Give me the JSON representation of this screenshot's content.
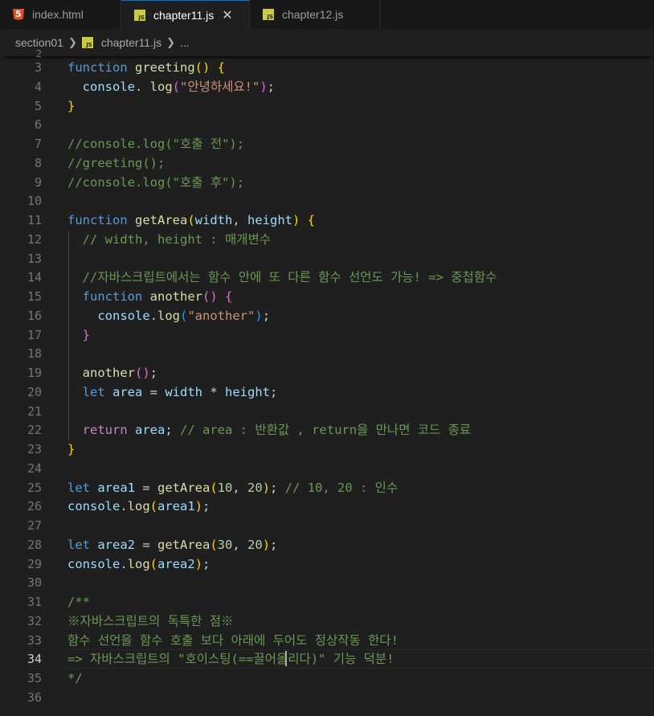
{
  "tabs": [
    {
      "label": "index.html",
      "icon": "html5-icon",
      "active": false
    },
    {
      "label": "chapter11.js",
      "icon": "js-icon",
      "active": true
    },
    {
      "label": "chapter12.js",
      "icon": "js-icon",
      "active": false
    }
  ],
  "breadcrumb": {
    "folder": "section01",
    "file": "chapter11.js",
    "more": "..."
  },
  "editor": {
    "first_line": 3,
    "current_line": 34,
    "gutter_top": "2",
    "lines": [
      [
        [
          "kw",
          "function "
        ],
        [
          "fn",
          "greeting"
        ],
        [
          "b1",
          "() {"
        ]
      ],
      [
        [
          "",
          "  "
        ],
        [
          "v",
          "console"
        ],
        [
          "",
          ". "
        ],
        [
          "fn",
          "log"
        ],
        [
          "b2",
          "("
        ],
        [
          "str",
          "\"안녕하세요!\""
        ],
        [
          "b2",
          ")"
        ],
        [
          "",
          ";"
        ]
      ],
      [
        [
          "b1",
          "}"
        ]
      ],
      [],
      [
        [
          "cm",
          "//console.log(\"호출 전\");"
        ]
      ],
      [
        [
          "cm",
          "//greeting();"
        ]
      ],
      [
        [
          "cm",
          "//console.log(\"호출 후\");"
        ]
      ],
      [],
      [
        [
          "kw",
          "function "
        ],
        [
          "fn",
          "getArea"
        ],
        [
          "b1",
          "("
        ],
        [
          "v",
          "width"
        ],
        [
          "",
          ", "
        ],
        [
          "v",
          "height"
        ],
        [
          "b1",
          ")"
        ],
        [
          "",
          " "
        ],
        [
          "b1",
          "{"
        ]
      ],
      [
        [
          "",
          "  "
        ],
        [
          "cm",
          "// width, height : 매개변수"
        ]
      ],
      [],
      [
        [
          "",
          "  "
        ],
        [
          "cm",
          "//자바스크립트에서는 함수 안에 또 다른 함수 선언도 가능! => 중첩함수"
        ]
      ],
      [
        [
          "",
          "  "
        ],
        [
          "kw",
          "function "
        ],
        [
          "fn",
          "another"
        ],
        [
          "b2",
          "() {"
        ]
      ],
      [
        [
          "",
          "    "
        ],
        [
          "v",
          "console"
        ],
        [
          "",
          "."
        ],
        [
          "fn",
          "log"
        ],
        [
          "b3",
          "("
        ],
        [
          "str",
          "\"another\""
        ],
        [
          "b3",
          ")"
        ],
        [
          "",
          ";"
        ]
      ],
      [
        [
          "",
          "  "
        ],
        [
          "b2",
          "}"
        ]
      ],
      [],
      [
        [
          "",
          "  "
        ],
        [
          "fn",
          "another"
        ],
        [
          "b2",
          "()"
        ],
        [
          "",
          ";"
        ]
      ],
      [
        [
          "",
          "  "
        ],
        [
          "kw",
          "let "
        ],
        [
          "v",
          "area"
        ],
        [
          "",
          " = "
        ],
        [
          "v",
          "width"
        ],
        [
          "",
          " * "
        ],
        [
          "v",
          "height"
        ],
        [
          "",
          ";"
        ]
      ],
      [],
      [
        [
          "",
          "  "
        ],
        [
          "ctl",
          "return "
        ],
        [
          "v",
          "area"
        ],
        [
          "",
          "; "
        ],
        [
          "cm",
          "// area : 반환값 , return을 만나면 코드 종료"
        ]
      ],
      [
        [
          "b1",
          "}"
        ]
      ],
      [],
      [
        [
          "kw",
          "let "
        ],
        [
          "v",
          "area1"
        ],
        [
          "",
          " = "
        ],
        [
          "fn",
          "getArea"
        ],
        [
          "b1",
          "("
        ],
        [
          "num",
          "10"
        ],
        [
          "",
          ", "
        ],
        [
          "num",
          "20"
        ],
        [
          "b1",
          ")"
        ],
        [
          "",
          "; "
        ],
        [
          "cm",
          "// 10, 20 : 인수"
        ]
      ],
      [
        [
          "v",
          "console"
        ],
        [
          "",
          "."
        ],
        [
          "fn",
          "log"
        ],
        [
          "b1",
          "("
        ],
        [
          "v",
          "area1"
        ],
        [
          "b1",
          ")"
        ],
        [
          "",
          ";"
        ]
      ],
      [],
      [
        [
          "kw",
          "let "
        ],
        [
          "v",
          "area2"
        ],
        [
          "",
          " = "
        ],
        [
          "fn",
          "getArea"
        ],
        [
          "b1",
          "("
        ],
        [
          "num",
          "30"
        ],
        [
          "",
          ", "
        ],
        [
          "num",
          "20"
        ],
        [
          "b1",
          ")"
        ],
        [
          "",
          ";"
        ]
      ],
      [
        [
          "v",
          "console"
        ],
        [
          "",
          "."
        ],
        [
          "fn",
          "log"
        ],
        [
          "b1",
          "("
        ],
        [
          "v",
          "area2"
        ],
        [
          "b1",
          ")"
        ],
        [
          "",
          ";"
        ]
      ],
      [],
      [
        [
          "cm",
          "/**"
        ]
      ],
      [
        [
          "cm",
          "※자바스크립트의 독특한 점※"
        ]
      ],
      [
        [
          "cm",
          "함수 선언을 함수 호출 보다 아래에 두어도 정상작동 한다!"
        ]
      ],
      [
        [
          "cm",
          "=> 자바스크립트의 \"호이스팅(==끌어올리다)\" 기능 덕분!"
        ]
      ],
      [
        [
          "cm",
          "*/"
        ]
      ],
      []
    ]
  },
  "colors": {
    "background": "#1f1f1f",
    "keyword": "#569cd6",
    "function": "#dcdcaa",
    "string": "#ce9178",
    "comment": "#6a9955",
    "number": "#b5cea8",
    "variable": "#9cdcfe",
    "control": "#c586c0"
  }
}
